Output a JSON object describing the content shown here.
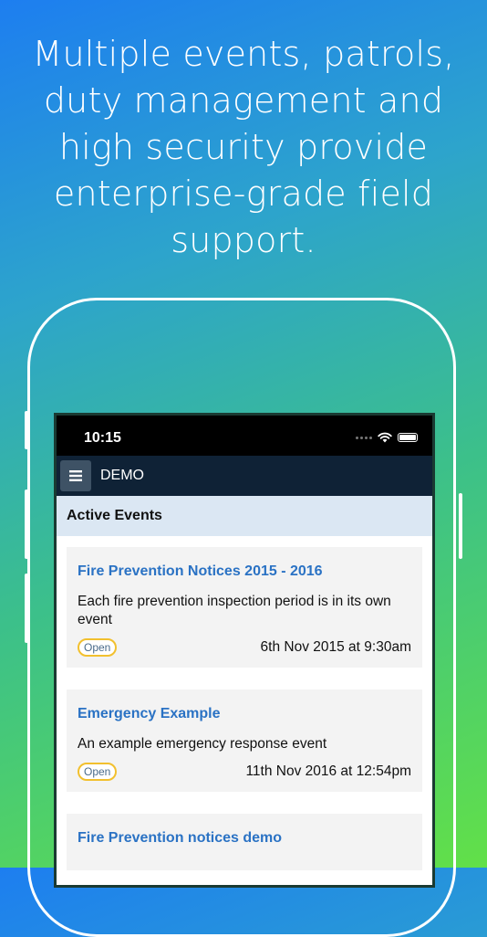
{
  "headline": {
    "lines": [
      "Multiple events, patrols,",
      "duty management and",
      "high security provide",
      "enterprise-grade field",
      "support."
    ]
  },
  "status_bar": {
    "time": "10:15"
  },
  "app_bar": {
    "title": "DEMO"
  },
  "section": {
    "title": "Active Events"
  },
  "events": [
    {
      "title": "Fire Prevention Notices 2015 - 2016",
      "description": "Each fire prevention inspection period is in its own event",
      "status": "Open",
      "date": "6th Nov 2015 at 9:30am"
    },
    {
      "title": "Emergency Example",
      "description": "An example emergency response event",
      "status": "Open",
      "date": "11th Nov 2016 at 12:54pm"
    },
    {
      "title": "Fire Prevention notices demo",
      "description": "",
      "status": "",
      "date": ""
    }
  ],
  "icons": {
    "menu": "hamburger-menu-icon",
    "wifi": "wifi-icon",
    "battery": "battery-icon"
  },
  "colors": {
    "app_bar": "#0f2236",
    "section_header": "#dbe7f3",
    "event_title": "#2a72c4",
    "badge_border": "#f2c02e"
  }
}
